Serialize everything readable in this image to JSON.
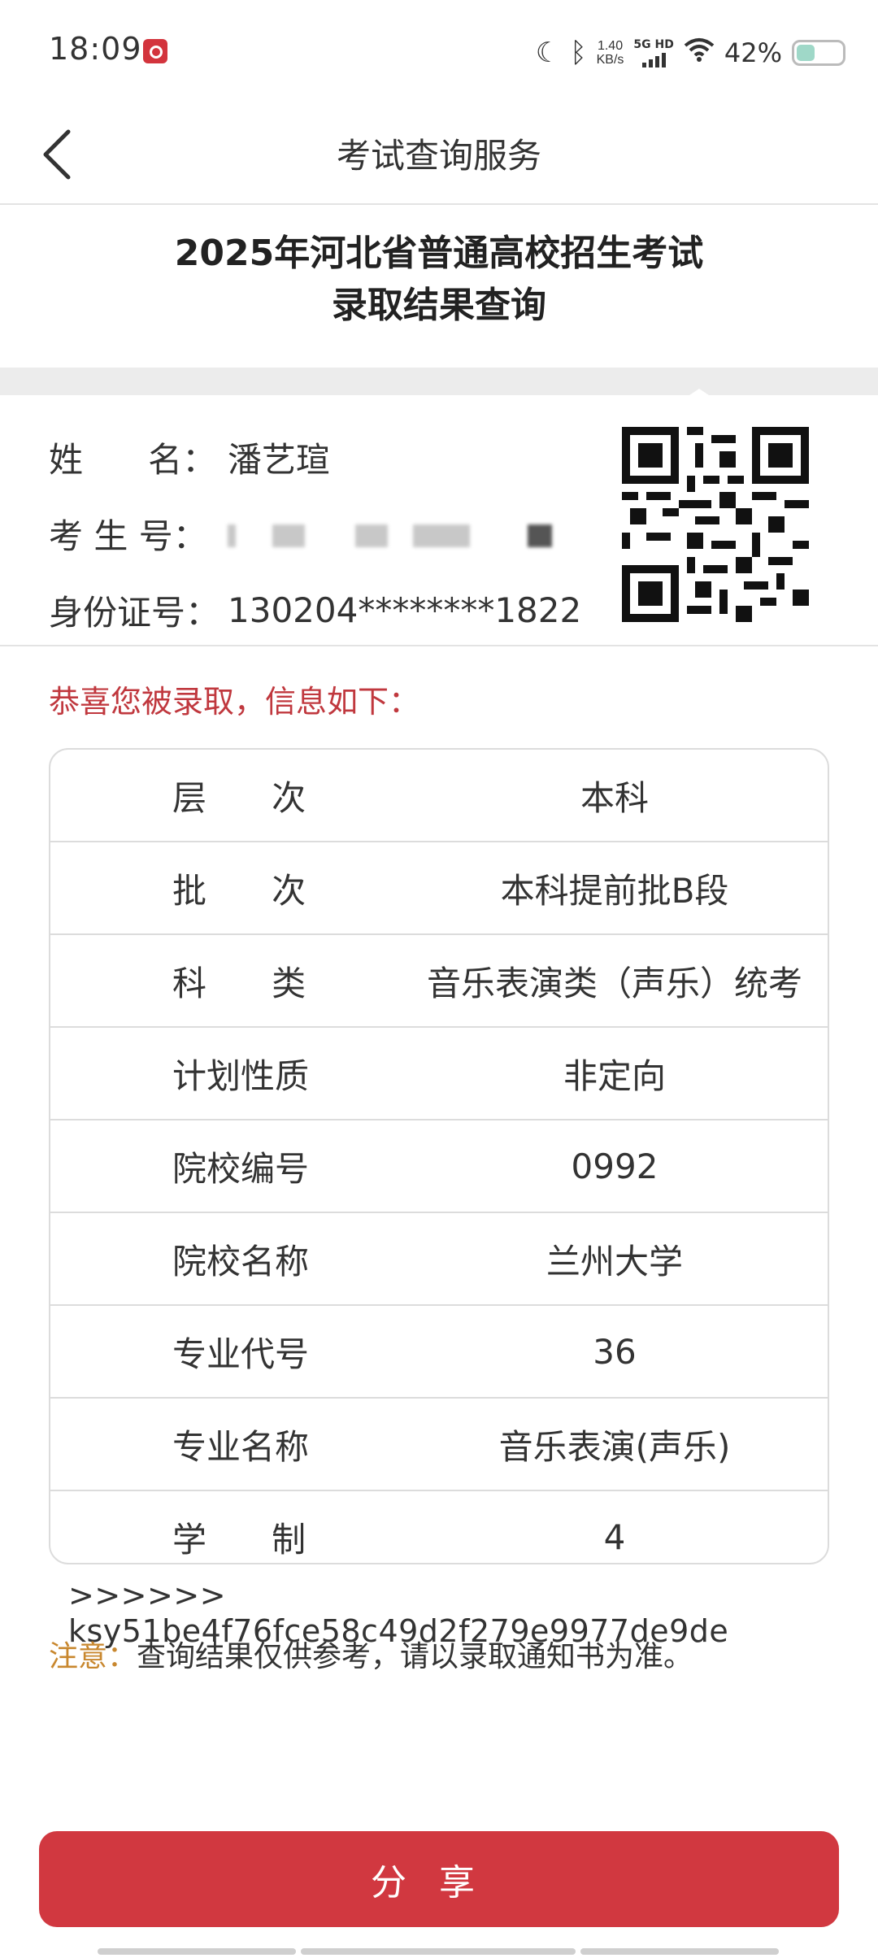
{
  "status_bar": {
    "time": "18:09",
    "speed_top": "1.40",
    "speed_bottom": "KB/s",
    "network_label": "5G HD",
    "battery": "42%",
    "icons": [
      "app-notification-icon",
      "moon-icon",
      "bluetooth-icon",
      "signal-icon",
      "wifi-icon",
      "battery-icon"
    ]
  },
  "nav": {
    "back_icon": "chevron-left-icon",
    "title": "考试查询服务"
  },
  "heading": {
    "line1": "2025年河北省普通高校招生考试",
    "line2": "录取结果查询"
  },
  "candidate": {
    "name_label": "姓      名：",
    "name_value": "潘艺瑄",
    "id_label": "考 生 号：",
    "id_value_blurred": true,
    "idcard_label": "身份证号：",
    "idcard_value": "130204********1822"
  },
  "congrats": "恭喜您被录取，信息如下：",
  "table": {
    "rows": [
      {
        "key": "层      次",
        "value": "本科"
      },
      {
        "key": "批      次",
        "value": "本科提前批B段"
      },
      {
        "key": "科      类",
        "value": "音乐表演类（声乐）统考"
      },
      {
        "key": "计划性质",
        "value": "非定向"
      },
      {
        "key": "院校编号",
        "value": "0992"
      },
      {
        "key": "院校名称",
        "value": "兰州大学"
      },
      {
        "key": "专业代号",
        "value": "36"
      },
      {
        "key": "专业名称",
        "value": "音乐表演(声乐)"
      },
      {
        "key": "学      制",
        "value": "4"
      }
    ]
  },
  "hash_line": ">>>>>> ksy51be4f76fce58c49d2f279e9977de9de",
  "notice": {
    "label": "注意：",
    "text": "查询结果仅供参考，请以录取通知书为准。"
  },
  "share_button": "分享",
  "colors": {
    "accent_red": "#d13840",
    "congrats_red": "#c0383e",
    "notice_orange": "#c8872e"
  }
}
